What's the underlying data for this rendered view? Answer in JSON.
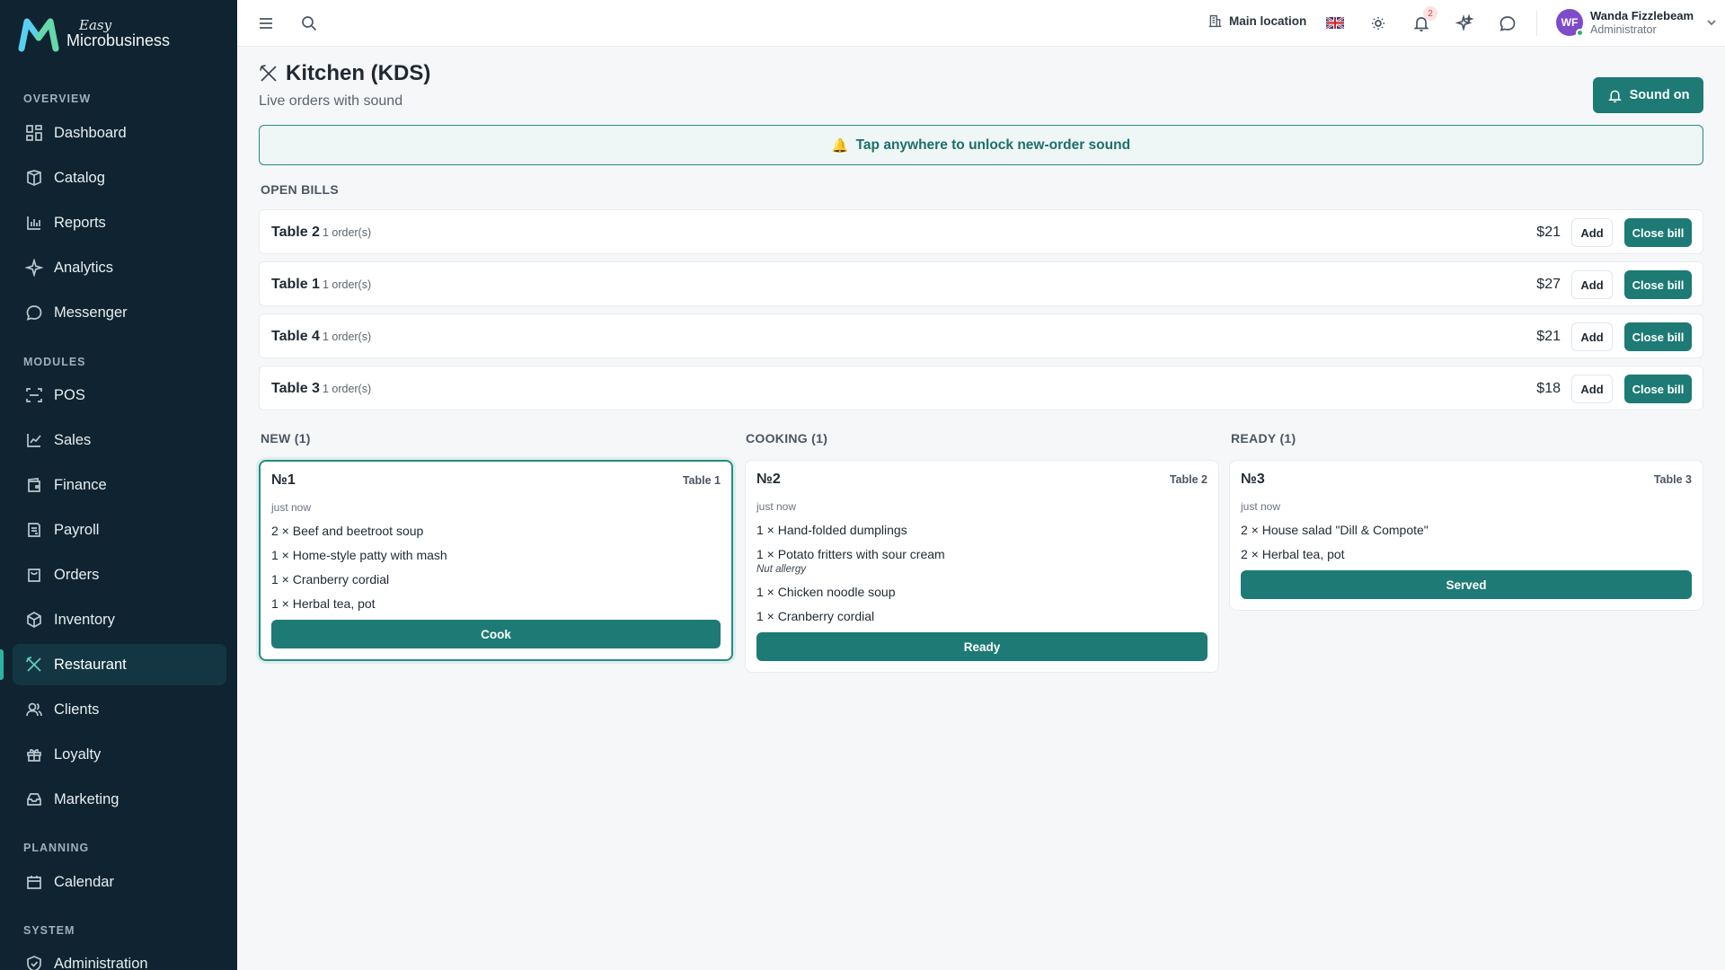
{
  "brand": {
    "easy": "Easy",
    "name": "Microbusiness"
  },
  "sidebar": {
    "sections": [
      {
        "label": "OVERVIEW"
      },
      {
        "label": "MODULES"
      },
      {
        "label": "PLANNING"
      },
      {
        "label": "SYSTEM"
      }
    ],
    "items": [
      {
        "label": "Dashboard",
        "icon": "dashboard-icon"
      },
      {
        "label": "Catalog",
        "icon": "catalog-icon"
      },
      {
        "label": "Reports",
        "icon": "reports-icon"
      },
      {
        "label": "Analytics",
        "icon": "analytics-icon"
      },
      {
        "label": "Messenger",
        "icon": "messenger-icon"
      },
      {
        "label": "POS",
        "icon": "pos-icon"
      },
      {
        "label": "Sales",
        "icon": "sales-icon"
      },
      {
        "label": "Finance",
        "icon": "finance-icon"
      },
      {
        "label": "Payroll",
        "icon": "payroll-icon"
      },
      {
        "label": "Orders",
        "icon": "orders-icon"
      },
      {
        "label": "Inventory",
        "icon": "inventory-icon"
      },
      {
        "label": "Restaurant",
        "icon": "restaurant-icon",
        "active": true
      },
      {
        "label": "Clients",
        "icon": "clients-icon"
      },
      {
        "label": "Loyalty",
        "icon": "loyalty-icon"
      },
      {
        "label": "Marketing",
        "icon": "marketing-icon"
      },
      {
        "label": "Calendar",
        "icon": "calendar-icon"
      },
      {
        "label": "Administration",
        "icon": "administration-icon"
      }
    ]
  },
  "header": {
    "location": "Main location",
    "notification_count": "2",
    "user": {
      "initials": "WF",
      "name": "Wanda Fizzlebeam",
      "role": "Administrator"
    }
  },
  "page": {
    "title": "Kitchen (KDS)",
    "subtitle": "Live orders with sound",
    "sound_button": "Sound on",
    "banner": "Tap anywhere to unlock new-order sound",
    "banner_emoji": "🔔"
  },
  "open_bills": {
    "label": "OPEN BILLS",
    "add_label": "Add",
    "close_label": "Close bill",
    "rows": [
      {
        "table": "Table 2",
        "orders": "1 order(s)",
        "total": "$21"
      },
      {
        "table": "Table 1",
        "orders": "1 order(s)",
        "total": "$27"
      },
      {
        "table": "Table 4",
        "orders": "1 order(s)",
        "total": "$21"
      },
      {
        "table": "Table 3",
        "orders": "1 order(s)",
        "total": "$18"
      }
    ]
  },
  "columns": [
    {
      "label": "NEW (1)",
      "orders": [
        {
          "number": "№1",
          "table": "Table 1",
          "time": "just now",
          "items": [
            "2 × Beef and beetroot soup",
            "1 × Home-style patty with mash",
            "1 × Cranberry cordial",
            "1 × Herbal tea, pot"
          ],
          "action": "Cook"
        }
      ]
    },
    {
      "label": "COOKING (1)",
      "orders": [
        {
          "number": "№2",
          "table": "Table 2",
          "time": "just now",
          "items": [
            "1 × Hand-folded dumplings",
            "1 × Potato fritters with sour cream",
            "1 × Chicken noodle soup",
            "1 × Cranberry cordial"
          ],
          "note": "Nut allergy",
          "action": "Ready"
        }
      ]
    },
    {
      "label": "READY (1)",
      "orders": [
        {
          "number": "№3",
          "table": "Table 3",
          "time": "just now",
          "items": [
            "2 × House salad \"Dill & Compote\"",
            "2 × Herbal tea, pot"
          ],
          "action": "Served"
        }
      ]
    }
  ],
  "colors": {
    "accent": "#1d7a74",
    "sidebar_bg": "#0f2430",
    "page_bg": "#f6f7f8"
  }
}
